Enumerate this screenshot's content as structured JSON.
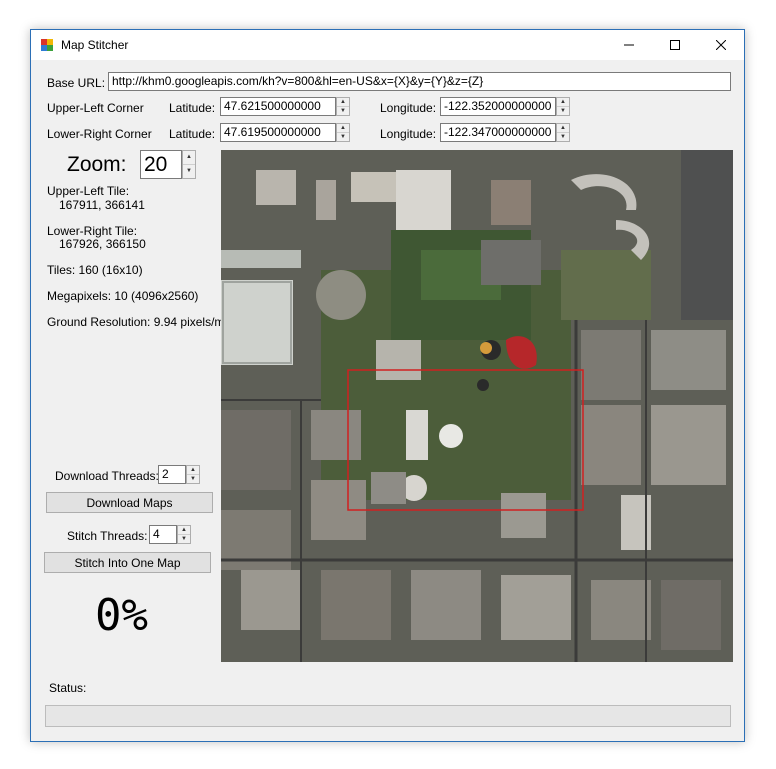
{
  "window": {
    "title": "Map Stitcher"
  },
  "base_url": {
    "label": "Base URL:",
    "value": "http://khm0.googleapis.com/kh?v=800&hl=en-US&x={X}&y={Y}&z={Z}"
  },
  "upper_left": {
    "label": "Upper-Left Corner",
    "lat_label": "Latitude:",
    "lat": "47.621500000000",
    "lon_label": "Longitude:",
    "lon": "-122.352000000000"
  },
  "lower_right": {
    "label": "Lower-Right Corner",
    "lat_label": "Latitude:",
    "lat": "47.619500000000",
    "lon_label": "Longitude:",
    "lon": "-122.347000000000"
  },
  "zoom": {
    "label": "Zoom:",
    "value": "20"
  },
  "info": {
    "upper_left_tile_label": "Upper-Left Tile:",
    "upper_left_tile": "167911, 366141",
    "lower_right_tile_label": "Lower-Right Tile:",
    "lower_right_tile": "167926, 366150",
    "tiles": "Tiles: 160 (16x10)",
    "megapixels": "Megapixels: 10 (4096x2560)",
    "ground_resolution": "Ground Resolution: 9.94 pixels/m"
  },
  "download": {
    "threads_label": "Download Threads:",
    "threads": "2",
    "button": "Download Maps"
  },
  "stitch": {
    "threads_label": "Stitch Threads:",
    "threads": "4",
    "button": "Stitch Into One Map"
  },
  "progress": {
    "text": "0%",
    "fraction": 0
  },
  "status": {
    "label": "Status:"
  },
  "icons": [
    "app-icon",
    "minimize-icon",
    "maximize-icon",
    "close-icon",
    "chevron-up-icon",
    "chevron-down-icon"
  ],
  "colors": {
    "selection_box": "#d02020",
    "window_border": "#2b6fb6",
    "progress_fill": "#06b025"
  }
}
